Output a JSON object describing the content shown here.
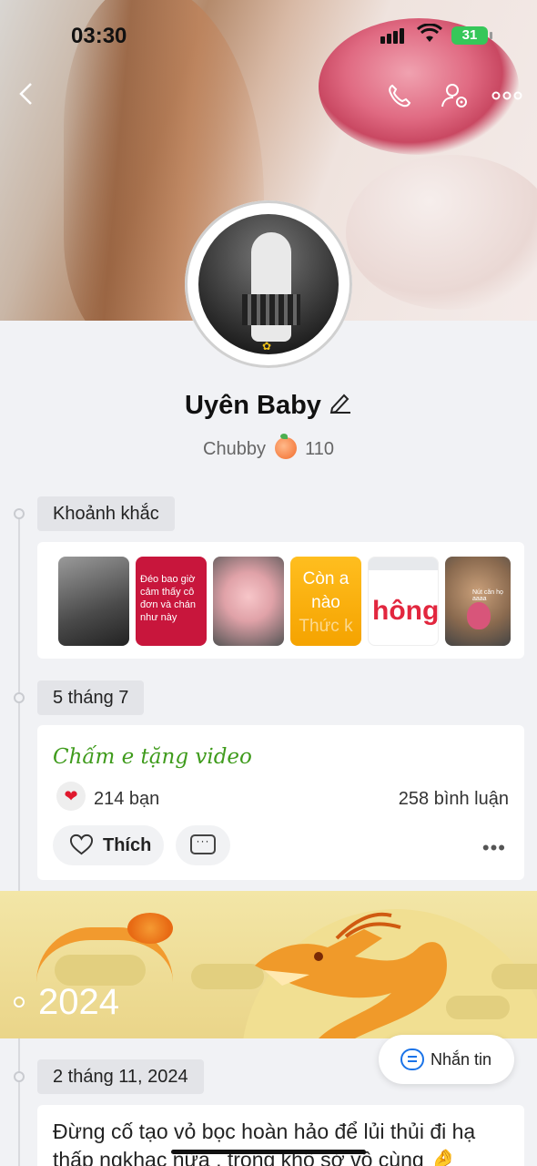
{
  "status_bar": {
    "time": "03:30",
    "battery": "31",
    "battery_color": "#36c759"
  },
  "header": {
    "back_icon": "chevron-left-icon",
    "call_icon": "phone-icon",
    "settings_icon": "user-settings-icon",
    "more_icon": "more-horizontal-icon"
  },
  "profile": {
    "name": "Uyên Baby",
    "tag": "Chubby",
    "count": "110"
  },
  "moments": {
    "label": "Khoảnh khắc",
    "thumbs": [
      {
        "text": ""
      },
      {
        "text": "Đéo bao giờ cảm thấy cô đơn và chán như này"
      },
      {
        "text": ""
      },
      {
        "text": "Còn a nào",
        "fade": "Thức k"
      },
      {
        "text": "hông"
      },
      {
        "text": "Nút căn họ aaaa"
      }
    ]
  },
  "post1": {
    "date": "5 tháng 7",
    "title": "Chấm e tặng video",
    "reactions": "214 bạn",
    "comments": "258 bình luận",
    "like_label": "Thích",
    "reaction_color": "#e0192e",
    "title_color": "#3f9b1c"
  },
  "year": {
    "label": "2024"
  },
  "message_button": {
    "label": "Nhắn tin",
    "icon_color": "#1a73e8"
  },
  "post2": {
    "date": "2 tháng 11, 2024",
    "text": "Đừng cố tạo vỏ bọc hoàn hảo để lủi thủi đi hạ thấp ngkhac nữa , trong khổ sở vô cùng 🤌"
  }
}
